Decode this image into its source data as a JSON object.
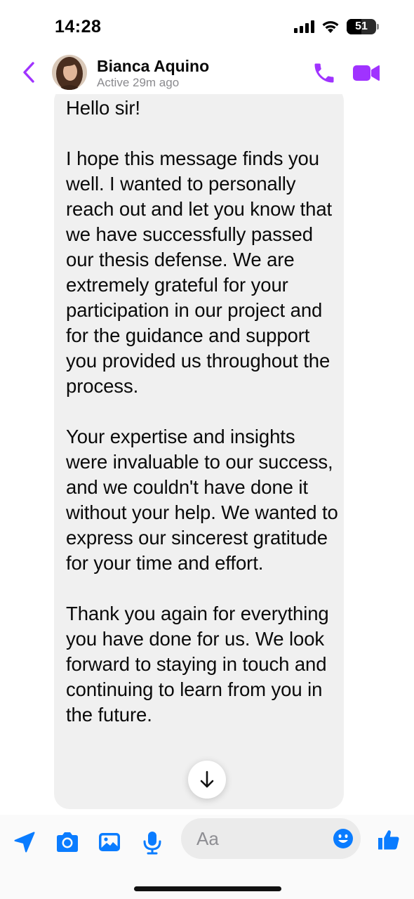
{
  "status_bar": {
    "time": "14:28",
    "battery_level": "51",
    "battery_fraction": 0.51,
    "icons": [
      "signal-icon",
      "wifi-icon",
      "battery-icon"
    ]
  },
  "header": {
    "contact_name": "Bianca Aquino",
    "presence": "Active 29m ago",
    "accent_color": "#a033ff",
    "icons": [
      "back-chevron-icon",
      "phone-icon",
      "video-camera-icon"
    ]
  },
  "conversation": {
    "messages": [
      {
        "text": "Hello sir!\n\nI hope this message finds you well. I wanted to personally reach out and let you know that we have successfully passed our thesis defense. We are extremely grateful for your participation in our project and for the guidance and support you provided us throughout the process.\n\nYour expertise and insights were invaluable to our success, and we couldn't have done it without your help. We wanted to express our sincerest gratitude for your time and effort.\n\nThank you again for everything you have done for us. We look forward to staying in touch and continuing to learn from you in the future."
      }
    ],
    "bubble_color": "#f0f0f0"
  },
  "composer": {
    "placeholder": "Aa",
    "icon_color": "#0a7cff",
    "icons": [
      "location-arrow-icon",
      "camera-icon",
      "photo-icon",
      "microphone-icon",
      "emoji-icon",
      "thumbs-up-icon"
    ]
  },
  "scroll_button": {
    "icon": "arrow-down-icon"
  }
}
